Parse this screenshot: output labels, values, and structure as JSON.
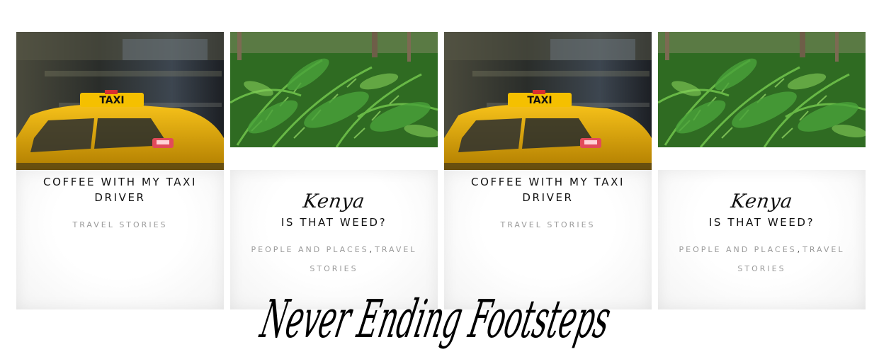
{
  "cards": [
    {
      "kind": "taxi",
      "image": "taxi-photo",
      "title": "COFFEE WITH MY TAXI DRIVER",
      "categories": [
        "TRAVEL STORIES"
      ]
    },
    {
      "kind": "fern",
      "image": "fern-photo",
      "location": "Kenya",
      "title": "IS THAT WEED?",
      "categories": [
        "PEOPLE AND PLACES",
        "TRAVEL STORIES"
      ]
    },
    {
      "kind": "taxi",
      "image": "taxi-photo",
      "title": "COFFEE WITH MY TAXI DRIVER",
      "categories": [
        "TRAVEL STORIES"
      ]
    },
    {
      "kind": "fern",
      "image": "fern-photo",
      "location": "Kenya",
      "title": "IS THAT WEED?",
      "categories": [
        "PEOPLE AND PLACES",
        "TRAVEL STORIES"
      ]
    }
  ],
  "taxi_sign": "TAXI",
  "site_logo": "Never Ending Footsteps",
  "colors": {
    "taxi_yellow": "#f2b705",
    "fern_green": "#3f8f2a",
    "title_text": "#111111",
    "category_text": "#9a9a9a"
  }
}
